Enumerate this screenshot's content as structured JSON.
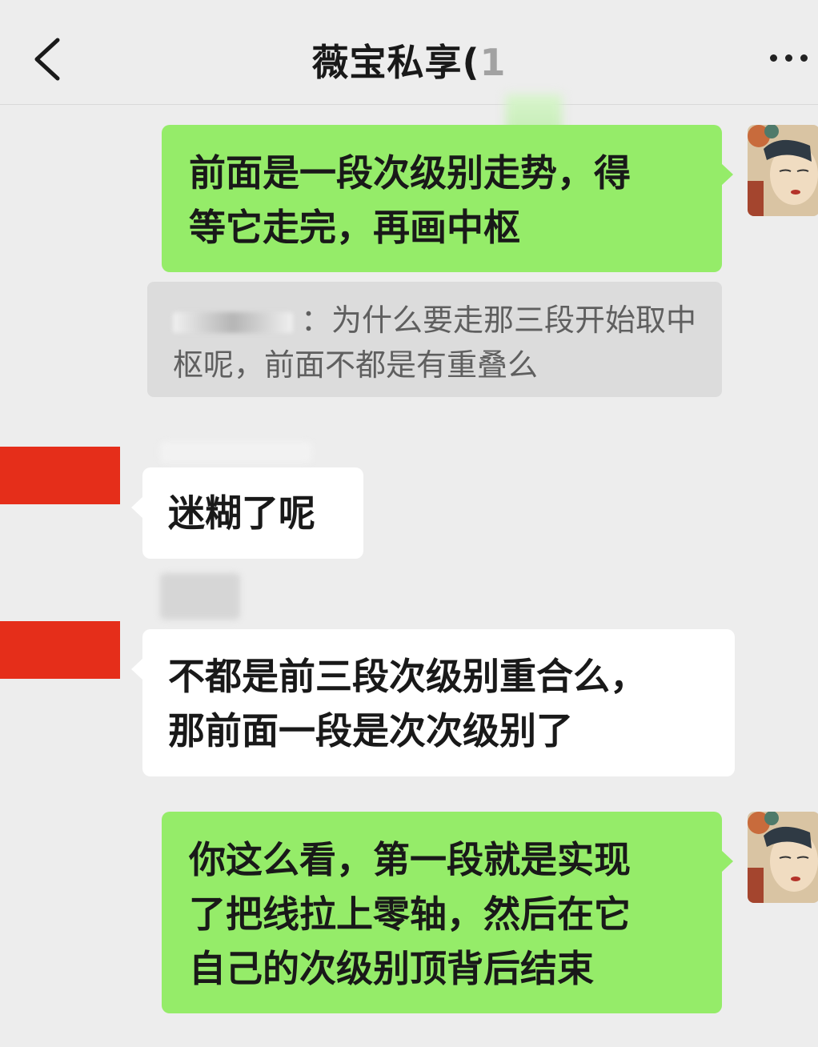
{
  "header": {
    "title": "薇宝私享(",
    "title_faded": "1"
  },
  "quote": {
    "separator": "：",
    "text": "为什么要走那三段开始取中枢呢，前面不都是有重叠么"
  },
  "messages": [
    {
      "side": "mine",
      "lines": [
        "前面是一段次级别走势，得",
        "等它走完，再画中枢"
      ]
    },
    {
      "side": "theirs",
      "lines": [
        "迷糊了呢"
      ]
    },
    {
      "side": "theirs",
      "lines": [
        "不都是前三段次级别重合么，",
        "那前面一段是次次级别了"
      ]
    },
    {
      "side": "mine",
      "lines": [
        "你这么看，第一段就是实现",
        "了把线拉上零轴，然后在它",
        "自己的次级别顶背后结束"
      ]
    }
  ],
  "icons": {
    "back": "chevron-left-icon",
    "more": "more-dots-icon"
  },
  "colors": {
    "mine_bubble": "#95ec69",
    "theirs_bubble": "#ffffff",
    "background": "#ededed",
    "redaction": "#e52e1a"
  }
}
